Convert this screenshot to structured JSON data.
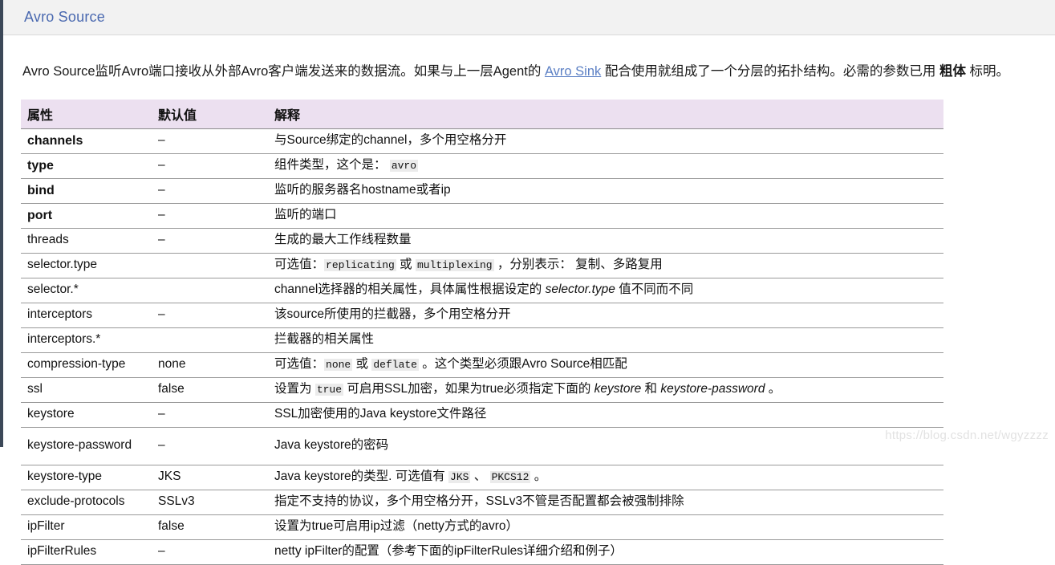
{
  "titlebar": {
    "title": "Avro Source"
  },
  "intro": {
    "part1": "Avro Source监听Avro端口接收从外部Avro客户端发送来的数据流。如果与上一层Agent的 ",
    "link": "Avro Sink",
    "part2": " 配合使用就组成了一个分层的拓扑结构。必需的参数已用 ",
    "bold": "粗体",
    "part3": " 标明。"
  },
  "table": {
    "headers": [
      "属性",
      "默认值",
      "解释"
    ],
    "rows": [
      {
        "name": "channels",
        "required": true,
        "default": "–",
        "desc_segments": [
          {
            "t": "text",
            "v": "与Source绑定的channel，多个用空格分开"
          }
        ]
      },
      {
        "name": "type",
        "required": true,
        "default": "–",
        "desc_segments": [
          {
            "t": "text",
            "v": "组件类型，这个是： "
          },
          {
            "t": "code",
            "v": "avro"
          }
        ]
      },
      {
        "name": "bind",
        "required": true,
        "default": "–",
        "desc_segments": [
          {
            "t": "text",
            "v": "监听的服务器名hostname或者ip"
          }
        ]
      },
      {
        "name": "port",
        "required": true,
        "default": "–",
        "desc_segments": [
          {
            "t": "text",
            "v": "监听的端口"
          }
        ]
      },
      {
        "name": "threads",
        "required": false,
        "default": "–",
        "desc_segments": [
          {
            "t": "text",
            "v": "生成的最大工作线程数量"
          }
        ]
      },
      {
        "name": "selector.type",
        "required": false,
        "default": "",
        "desc_segments": [
          {
            "t": "text",
            "v": "可选值："
          },
          {
            "t": "code",
            "v": "replicating"
          },
          {
            "t": "text",
            "v": " 或 "
          },
          {
            "t": "code",
            "v": "multiplexing"
          },
          {
            "t": "text",
            "v": " ，分别表示： 复制、多路复用"
          }
        ]
      },
      {
        "name": "selector.*",
        "required": false,
        "default": "",
        "desc_segments": [
          {
            "t": "text",
            "v": "channel选择器的相关属性，具体属性根据设定的 "
          },
          {
            "t": "italic",
            "v": "selector.type"
          },
          {
            "t": "text",
            "v": " 值不同而不同"
          }
        ]
      },
      {
        "name": "interceptors",
        "required": false,
        "default": "–",
        "desc_segments": [
          {
            "t": "text",
            "v": "该source所使用的拦截器，多个用空格分开"
          }
        ]
      },
      {
        "name": "interceptors.*",
        "required": false,
        "default": "",
        "desc_segments": [
          {
            "t": "text",
            "v": "拦截器的相关属性"
          }
        ]
      },
      {
        "name": "compression-type",
        "required": false,
        "default": "none",
        "desc_segments": [
          {
            "t": "text",
            "v": "可选值："
          },
          {
            "t": "code",
            "v": "none"
          },
          {
            "t": "text",
            "v": " 或 "
          },
          {
            "t": "code",
            "v": "deflate"
          },
          {
            "t": "text",
            "v": " 。这个类型必须跟Avro Source相匹配"
          }
        ]
      },
      {
        "name": "ssl",
        "required": false,
        "default": "false",
        "desc_segments": [
          {
            "t": "text",
            "v": "设置为 "
          },
          {
            "t": "code",
            "v": "true"
          },
          {
            "t": "text",
            "v": " 可启用SSL加密，如果为true必须指定下面的 "
          },
          {
            "t": "italic",
            "v": "keystore"
          },
          {
            "t": "text",
            "v": " 和 "
          },
          {
            "t": "italic",
            "v": "keystore-password"
          },
          {
            "t": "text",
            "v": " 。"
          }
        ]
      },
      {
        "name": "keystore",
        "required": false,
        "default": "–",
        "desc_segments": [
          {
            "t": "text",
            "v": "SSL加密使用的Java keystore文件路径"
          }
        ]
      },
      {
        "name": "keystore-password",
        "required": false,
        "default": "–",
        "tall": true,
        "desc_segments": [
          {
            "t": "text",
            "v": "Java keystore的密码"
          }
        ]
      },
      {
        "name": "keystore-type",
        "required": false,
        "default": "JKS",
        "desc_segments": [
          {
            "t": "text",
            "v": "Java keystore的类型. 可选值有 "
          },
          {
            "t": "code",
            "v": "JKS"
          },
          {
            "t": "text",
            "v": " 、 "
          },
          {
            "t": "code",
            "v": "PKCS12"
          },
          {
            "t": "text",
            "v": " 。"
          }
        ]
      },
      {
        "name": "exclude-protocols",
        "required": false,
        "default": "SSLv3",
        "desc_segments": [
          {
            "t": "text",
            "v": "指定不支持的协议，多个用空格分开，SSLv3不管是否配置都会被强制排除"
          }
        ]
      },
      {
        "name": "ipFilter",
        "required": false,
        "default": "false",
        "desc_segments": [
          {
            "t": "text",
            "v": "设置为true可启用ip过滤（netty方式的avro）"
          }
        ]
      },
      {
        "name": "ipFilterRules",
        "required": false,
        "default": "–",
        "desc_segments": [
          {
            "t": "text",
            "v": "netty ipFilter的配置（参考下面的ipFilterRules详细介绍和例子）"
          }
        ]
      }
    ]
  },
  "watermark": "https://blog.csdn.net/wgyzzzz"
}
